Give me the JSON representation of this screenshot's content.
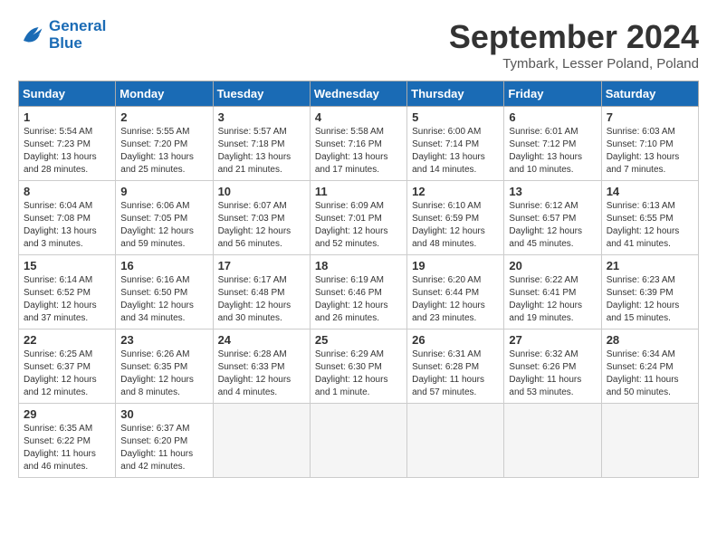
{
  "header": {
    "logo_line1": "General",
    "logo_line2": "Blue",
    "month": "September 2024",
    "location": "Tymbark, Lesser Poland, Poland"
  },
  "days_of_week": [
    "Sunday",
    "Monday",
    "Tuesday",
    "Wednesday",
    "Thursday",
    "Friday",
    "Saturday"
  ],
  "weeks": [
    [
      {
        "num": "1",
        "sunrise": "5:54 AM",
        "sunset": "7:23 PM",
        "daylight": "13 hours and 28 minutes."
      },
      {
        "num": "2",
        "sunrise": "5:55 AM",
        "sunset": "7:20 PM",
        "daylight": "13 hours and 25 minutes."
      },
      {
        "num": "3",
        "sunrise": "5:57 AM",
        "sunset": "7:18 PM",
        "daylight": "13 hours and 21 minutes."
      },
      {
        "num": "4",
        "sunrise": "5:58 AM",
        "sunset": "7:16 PM",
        "daylight": "13 hours and 17 minutes."
      },
      {
        "num": "5",
        "sunrise": "6:00 AM",
        "sunset": "7:14 PM",
        "daylight": "13 hours and 14 minutes."
      },
      {
        "num": "6",
        "sunrise": "6:01 AM",
        "sunset": "7:12 PM",
        "daylight": "13 hours and 10 minutes."
      },
      {
        "num": "7",
        "sunrise": "6:03 AM",
        "sunset": "7:10 PM",
        "daylight": "13 hours and 7 minutes."
      }
    ],
    [
      {
        "num": "8",
        "sunrise": "6:04 AM",
        "sunset": "7:08 PM",
        "daylight": "13 hours and 3 minutes."
      },
      {
        "num": "9",
        "sunrise": "6:06 AM",
        "sunset": "7:05 PM",
        "daylight": "12 hours and 59 minutes."
      },
      {
        "num": "10",
        "sunrise": "6:07 AM",
        "sunset": "7:03 PM",
        "daylight": "12 hours and 56 minutes."
      },
      {
        "num": "11",
        "sunrise": "6:09 AM",
        "sunset": "7:01 PM",
        "daylight": "12 hours and 52 minutes."
      },
      {
        "num": "12",
        "sunrise": "6:10 AM",
        "sunset": "6:59 PM",
        "daylight": "12 hours and 48 minutes."
      },
      {
        "num": "13",
        "sunrise": "6:12 AM",
        "sunset": "6:57 PM",
        "daylight": "12 hours and 45 minutes."
      },
      {
        "num": "14",
        "sunrise": "6:13 AM",
        "sunset": "6:55 PM",
        "daylight": "12 hours and 41 minutes."
      }
    ],
    [
      {
        "num": "15",
        "sunrise": "6:14 AM",
        "sunset": "6:52 PM",
        "daylight": "12 hours and 37 minutes."
      },
      {
        "num": "16",
        "sunrise": "6:16 AM",
        "sunset": "6:50 PM",
        "daylight": "12 hours and 34 minutes."
      },
      {
        "num": "17",
        "sunrise": "6:17 AM",
        "sunset": "6:48 PM",
        "daylight": "12 hours and 30 minutes."
      },
      {
        "num": "18",
        "sunrise": "6:19 AM",
        "sunset": "6:46 PM",
        "daylight": "12 hours and 26 minutes."
      },
      {
        "num": "19",
        "sunrise": "6:20 AM",
        "sunset": "6:44 PM",
        "daylight": "12 hours and 23 minutes."
      },
      {
        "num": "20",
        "sunrise": "6:22 AM",
        "sunset": "6:41 PM",
        "daylight": "12 hours and 19 minutes."
      },
      {
        "num": "21",
        "sunrise": "6:23 AM",
        "sunset": "6:39 PM",
        "daylight": "12 hours and 15 minutes."
      }
    ],
    [
      {
        "num": "22",
        "sunrise": "6:25 AM",
        "sunset": "6:37 PM",
        "daylight": "12 hours and 12 minutes."
      },
      {
        "num": "23",
        "sunrise": "6:26 AM",
        "sunset": "6:35 PM",
        "daylight": "12 hours and 8 minutes."
      },
      {
        "num": "24",
        "sunrise": "6:28 AM",
        "sunset": "6:33 PM",
        "daylight": "12 hours and 4 minutes."
      },
      {
        "num": "25",
        "sunrise": "6:29 AM",
        "sunset": "6:30 PM",
        "daylight": "12 hours and 1 minute."
      },
      {
        "num": "26",
        "sunrise": "6:31 AM",
        "sunset": "6:28 PM",
        "daylight": "11 hours and 57 minutes."
      },
      {
        "num": "27",
        "sunrise": "6:32 AM",
        "sunset": "6:26 PM",
        "daylight": "11 hours and 53 minutes."
      },
      {
        "num": "28",
        "sunrise": "6:34 AM",
        "sunset": "6:24 PM",
        "daylight": "11 hours and 50 minutes."
      }
    ],
    [
      {
        "num": "29",
        "sunrise": "6:35 AM",
        "sunset": "6:22 PM",
        "daylight": "11 hours and 46 minutes."
      },
      {
        "num": "30",
        "sunrise": "6:37 AM",
        "sunset": "6:20 PM",
        "daylight": "11 hours and 42 minutes."
      },
      null,
      null,
      null,
      null,
      null
    ]
  ]
}
